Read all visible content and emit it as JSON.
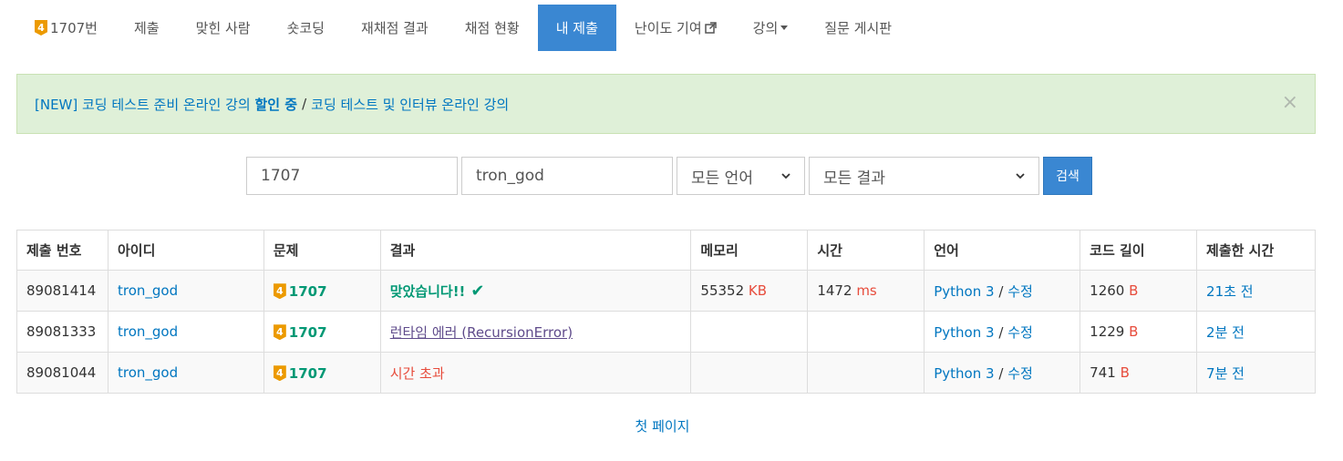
{
  "nav": {
    "problem_tier": "4",
    "items": [
      {
        "label": "1707번"
      },
      {
        "label": "제출"
      },
      {
        "label": "맞힌 사람"
      },
      {
        "label": "숏코딩"
      },
      {
        "label": "재채점 결과"
      },
      {
        "label": "채점 현황"
      },
      {
        "label": "내 제출"
      },
      {
        "label": "난이도 기여"
      },
      {
        "label": "강의"
      },
      {
        "label": "질문 게시판"
      }
    ]
  },
  "alert": {
    "prefix": "[NEW] 코딩 테스트 준비 온라인 강의",
    "bold": "할인 중",
    "separator": "/",
    "suffix": "코딩 테스트 및 인터뷰 온라인 강의",
    "close": "×"
  },
  "filters": {
    "problem_id": "1707",
    "user_id": "tron_god",
    "language": "모든 언어",
    "result": "모든 결과",
    "search_label": "검색"
  },
  "table": {
    "headers": [
      "제출 번호",
      "아이디",
      "문제",
      "결과",
      "메모리",
      "시간",
      "언어",
      "코드 길이",
      "제출한 시간"
    ],
    "memory_unit": "KB",
    "time_unit": "ms",
    "length_unit": "B",
    "edit_sep": "/",
    "edit_label": "수정",
    "rows": [
      {
        "id": "89081414",
        "user": "tron_god",
        "tier": "4",
        "problem": "1707",
        "result": "맞았습니다!!",
        "memory": "55352",
        "time": "1472",
        "lang": "Python 3",
        "length": "1260",
        "submitted": "21초 전"
      },
      {
        "id": "89081333",
        "user": "tron_god",
        "tier": "4",
        "problem": "1707",
        "result": "런타임 에러 (RecursionError)",
        "memory": "",
        "time": "",
        "lang": "Python 3",
        "length": "1229",
        "submitted": "2분 전"
      },
      {
        "id": "89081044",
        "user": "tron_god",
        "tier": "4",
        "problem": "1707",
        "result": "시간 초과",
        "memory": "",
        "time": "",
        "lang": "Python 3",
        "length": "741",
        "submitted": "7분 전"
      }
    ]
  },
  "pager": {
    "first_page": "첫 페이지"
  },
  "colors": {
    "accent": "#3a87d2",
    "accepted": "#009874",
    "error": "#e74c3c",
    "tier": "#ec9a00"
  }
}
